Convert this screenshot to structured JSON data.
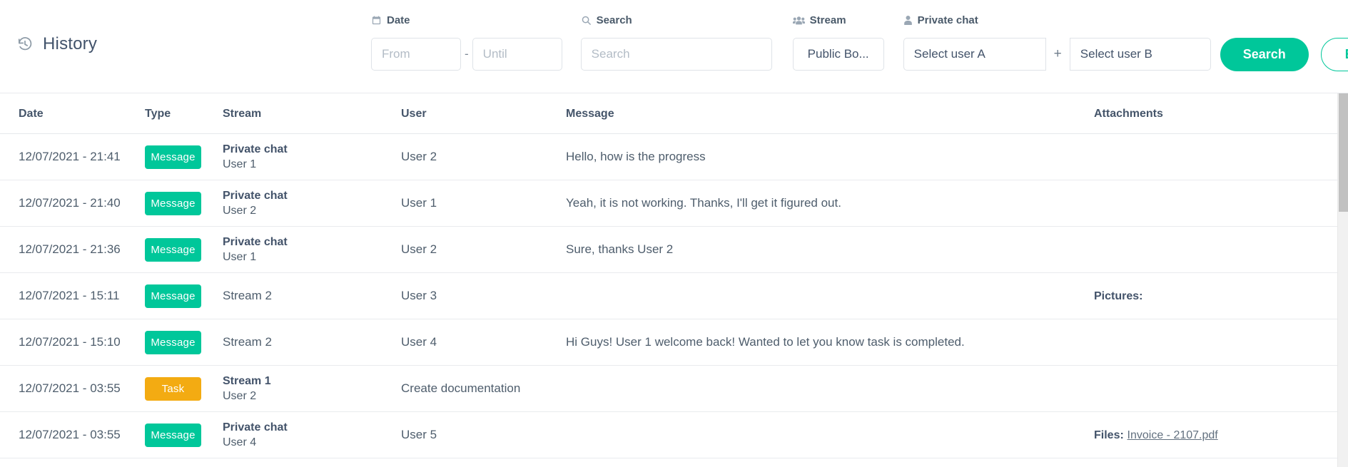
{
  "header": {
    "title": "History",
    "icon": "history-icon"
  },
  "filters": {
    "date": {
      "label": "Date",
      "icon": "calendar-icon",
      "from_placeholder": "From",
      "from_value": "",
      "separator": "-",
      "until_placeholder": "Until",
      "until_value": ""
    },
    "search": {
      "label": "Search",
      "icon": "search-icon",
      "placeholder": "Search",
      "value": ""
    },
    "stream": {
      "label": "Stream",
      "icon": "users-group-icon",
      "selected": "Public Bo..."
    },
    "private_chat": {
      "label": "Private chat",
      "icon": "user-icon",
      "user_a": "Select user A",
      "plus": "+",
      "user_b": "Select user B"
    }
  },
  "actions": {
    "search_label": "Search",
    "export_label": "Export"
  },
  "colors": {
    "accent": "#00c79a",
    "task": "#f3ab12",
    "text": "#4e5d6c",
    "heading": "#43536a"
  },
  "table": {
    "columns": [
      "Date",
      "Type",
      "Stream",
      "User",
      "Message",
      "Attachments"
    ],
    "rows": [
      {
        "date": "12/07/2021 - 21:41",
        "type": "Message",
        "type_kind": "message",
        "stream_main": "Private chat",
        "stream_sub": "User 1",
        "user": "User 2",
        "message": "Hello, how is the progress",
        "attachment_label": "",
        "attachment_link": ""
      },
      {
        "date": "12/07/2021 - 21:40",
        "type": "Message",
        "type_kind": "message",
        "stream_main": "Private chat",
        "stream_sub": "User 2",
        "user": "User 1",
        "message": "Yeah, it is not working. Thanks, I'll get it figured out.",
        "attachment_label": "",
        "attachment_link": ""
      },
      {
        "date": "12/07/2021 - 21:36",
        "type": "Message",
        "type_kind": "message",
        "stream_main": "Private chat",
        "stream_sub": "User 1",
        "user": "User 2",
        "message": "Sure, thanks User 2",
        "attachment_label": "",
        "attachment_link": ""
      },
      {
        "date": "12/07/2021 - 15:11",
        "type": "Message",
        "type_kind": "message",
        "stream_main": "",
        "stream_sub": "",
        "stream_single": "Stream 2",
        "user": "User 3",
        "message": "",
        "attachment_label": "Pictures:",
        "attachment_link": ""
      },
      {
        "date": "12/07/2021 - 15:10",
        "type": "Message",
        "type_kind": "message",
        "stream_main": "",
        "stream_sub": "",
        "stream_single": "Stream 2",
        "user": "User 4",
        "message": "Hi Guys! User 1 welcome back! Wanted to let you know task is completed.",
        "attachment_label": "",
        "attachment_link": ""
      },
      {
        "date": "12/07/2021 - 03:55",
        "type": "Task",
        "type_kind": "task",
        "stream_main": "Stream 1",
        "stream_sub": "User 2",
        "user": "Create documentation",
        "message": "",
        "attachment_label": "",
        "attachment_link": ""
      },
      {
        "date": "12/07/2021 - 03:55",
        "type": "Message",
        "type_kind": "message",
        "stream_main": "Private chat",
        "stream_sub": "User 4",
        "user": "User 5",
        "message": "",
        "attachment_label": "Files:",
        "attachment_link": "Invoice - 2107.pdf"
      }
    ]
  }
}
